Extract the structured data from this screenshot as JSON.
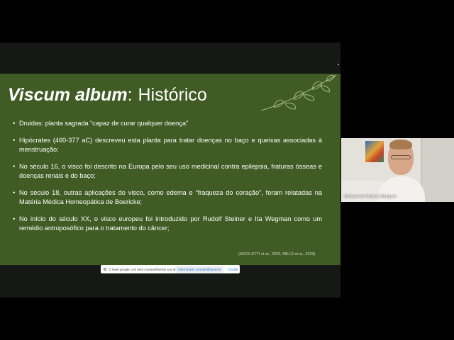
{
  "slide": {
    "title_italic": "Viscum album",
    "title_separator": ":",
    "title_rest": "Histórico",
    "bullets": [
      "Druidas: planta sagrada “capaz de curar qualquer doença”",
      "Hipócrates (460-377 aC) descreveu esta planta para tratar doenças no baço e queixas associadas à menstruação;",
      "No século 16, o visco foi descrito na Europa pelo seu uso medicinal contra epilepsia, fraturas ósseas e doenças renais e do baço;",
      "No século 18, outras aplicações do visco, como edema e “fraqueza do coração”, foram relatadas na Matéria Médica Homeopática de Boericke;",
      "No início do século XX, o visco europeu foi introduzido por Rudolf Steiner e Ita Wegman como um remédio antroposófico para o tratamento do câncer;"
    ],
    "citation": "(NICOLETTI et al., 2023; MELO et al., 2023)"
  },
  "share_bar": {
    "message": "O meet.google.com está compartilhando sua tela.",
    "stop_label": "Interromper compartilhamento",
    "hide_label": "Ocultar"
  },
  "participant": {
    "name": "Mikhael de Mattos Marques"
  },
  "colors": {
    "slide_background": "#405b24",
    "stage_background": "#151815",
    "link_blue": "#1a73e8"
  },
  "icons": [
    "leaf-branch-decoration",
    "screen-share-icon"
  ]
}
